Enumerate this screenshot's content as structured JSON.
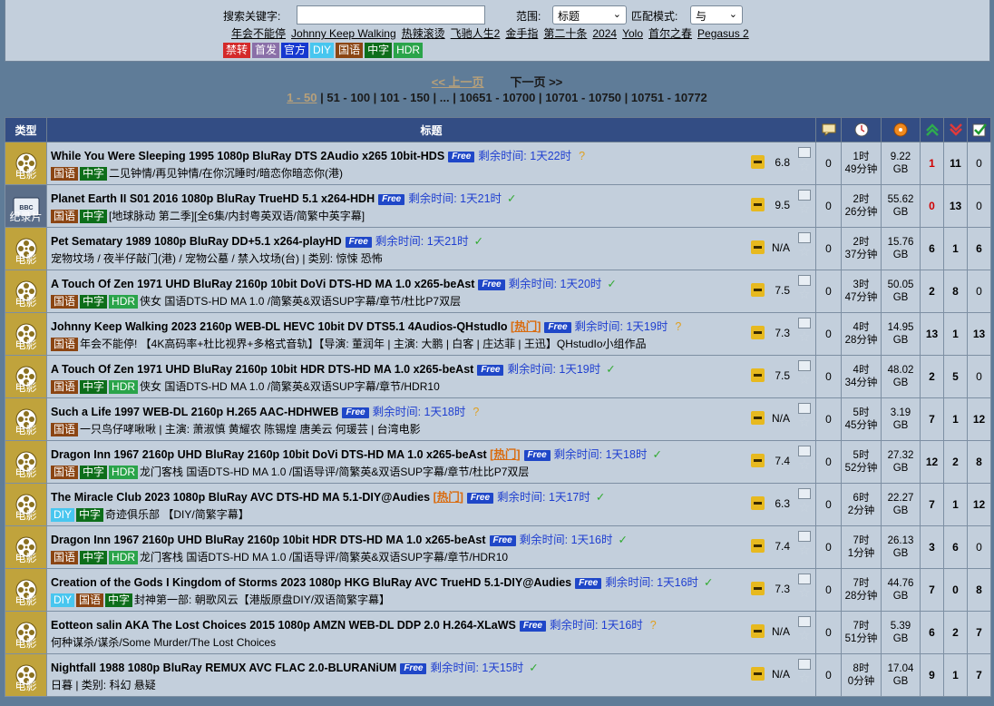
{
  "search": {
    "keyword_label": "搜索关键字:",
    "keyword_value": "",
    "scope_label": "范围:",
    "scope_value": "标题",
    "mode_label": "匹配模式:",
    "mode_value": "与",
    "hot_terms": [
      "年会不能停",
      "Johnny Keep Walking",
      "热辣滚烫",
      "飞驰人生2",
      "金手指",
      "第二十条",
      "2024",
      "Yolo",
      "首尔之春",
      "Pegasus 2"
    ],
    "filter_tags": [
      {
        "label": "禁转",
        "color": "#d42a2a"
      },
      {
        "label": "首发",
        "color": "#8a6fa8"
      },
      {
        "label": "官方",
        "color": "#1638d0"
      },
      {
        "label": "DIY",
        "color": "#48c6ef"
      },
      {
        "label": "国语",
        "color": "#8b4513"
      },
      {
        "label": "中字",
        "color": "#0d6e1a"
      },
      {
        "label": "HDR",
        "color": "#2aa44a"
      }
    ]
  },
  "pager": {
    "prev": "<< 上一页",
    "next": "下一页 >>",
    "current": "1 - 50",
    "pages": [
      "51 - 100",
      "101 - 150",
      "...",
      "10651 - 10700",
      "10701 - 10750",
      "10751 - 10772"
    ]
  },
  "table": {
    "col_type": "类型",
    "col_title": "标题",
    "rows": [
      {
        "type": "电影",
        "title": "While You Were Sleeping 1995 1080p BluRay DTS 2Audio x265 10bit-HDS",
        "hot": false,
        "remaining": "剩余时间: 1天22时",
        "mark": "?",
        "tags": [
          "国语",
          "中字"
        ],
        "sub": "二见钟情/再见钟情/在你沉睡时/暗恋你暗恋你(港)",
        "rating": "6.8",
        "comments": "0",
        "time1": "1时",
        "time2": "49分钟",
        "size1": "9.22",
        "size2": "GB",
        "seeders": "1",
        "leechers": "11",
        "done": "0",
        "seed_red": true
      },
      {
        "type": "纪录片",
        "title": "Planet Earth II S01 2016 1080p BluRay TrueHD 5.1 x264-HDH",
        "hot": false,
        "remaining": "剩余时间: 1天21时",
        "mark": "✓",
        "tags": [
          "国语",
          "中字"
        ],
        "sub": "[地球脉动 第二季][全6集/内封粤英双语/简繁中英字幕]",
        "rating": "9.5",
        "comments": "0",
        "time1": "2时",
        "time2": "26分钟",
        "size1": "55.62",
        "size2": "GB",
        "seeders": "0",
        "leechers": "13",
        "done": "0",
        "seed_red": true
      },
      {
        "type": "电影",
        "title": "Pet Sematary 1989 1080p BluRay DD+5.1 x264-playHD",
        "hot": false,
        "remaining": "剩余时间: 1天21时",
        "mark": "✓",
        "tags": [],
        "sub": "宠物坟场 / 夜半仔敲门(港) / 宠物公墓 / 禁入坟场(台) | 类别: 惊悚 恐怖",
        "rating": "N/A",
        "comments": "0",
        "time1": "2时",
        "time2": "37分钟",
        "size1": "15.76",
        "size2": "GB",
        "seeders": "6",
        "leechers": "1",
        "done": "6",
        "seed_red": false
      },
      {
        "type": "电影",
        "title": "A Touch Of Zen 1971 UHD BluRay 2160p 10bit DoVi DTS-HD MA 1.0 x265-beAst",
        "hot": false,
        "remaining": "剩余时间: 1天20时",
        "mark": "✓",
        "tags": [
          "国语",
          "中字",
          "HDR"
        ],
        "sub": "侠女 国语DTS-HD MA 1.0 /简繁英&双语SUP字幕/章节/杜比P7双层",
        "rating": "7.5",
        "comments": "0",
        "time1": "3时",
        "time2": "47分钟",
        "size1": "50.05",
        "size2": "GB",
        "seeders": "2",
        "leechers": "8",
        "done": "0",
        "seed_red": false
      },
      {
        "type": "电影",
        "title": "Johnny Keep Walking 2023 2160p WEB-DL HEVC 10bit DV DTS5.1 4Audios-QHstudIo",
        "hot": true,
        "remaining": "剩余时间: 1天19时",
        "mark": "?",
        "tags": [
          "国语"
        ],
        "sub": "年会不能停! 【4K高码率+杜比视界+多格式音轨】【导演: 董润年 | 主演: 大鹏 | 白客 | 庄达菲 | 王迅】QHstudIo小组作品",
        "rating": "7.3",
        "comments": "0",
        "time1": "4时",
        "time2": "28分钟",
        "size1": "14.95",
        "size2": "GB",
        "seeders": "13",
        "leechers": "1",
        "done": "13",
        "seed_red": false
      },
      {
        "type": "电影",
        "title": "A Touch Of Zen 1971 UHD BluRay 2160p 10bit HDR DTS-HD MA 1.0 x265-beAst",
        "hot": false,
        "remaining": "剩余时间: 1天19时",
        "mark": "✓",
        "tags": [
          "国语",
          "中字",
          "HDR"
        ],
        "sub": "侠女 国语DTS-HD MA 1.0 /简繁英&双语SUP字幕/章节/HDR10",
        "rating": "7.5",
        "comments": "0",
        "time1": "4时",
        "time2": "34分钟",
        "size1": "48.02",
        "size2": "GB",
        "seeders": "2",
        "leechers": "5",
        "done": "0",
        "seed_red": false
      },
      {
        "type": "电影",
        "title": "Such a Life 1997 WEB-DL 2160p H.265 AAC-HDHWEB",
        "hot": false,
        "remaining": "剩余时间: 1天18时",
        "mark": "?",
        "tags": [
          "国语"
        ],
        "sub": "一只鸟仔哮啾啾 | 主演: 萧淑慎 黄耀农 陈锡煌 唐美云 何瑗芸 | 台湾电影",
        "rating": "N/A",
        "comments": "0",
        "time1": "5时",
        "time2": "45分钟",
        "size1": "3.19",
        "size2": "GB",
        "seeders": "7",
        "leechers": "1",
        "done": "12",
        "seed_red": false
      },
      {
        "type": "电影",
        "title": "Dragon Inn 1967 2160p UHD BluRay 2160p 10bit DoVi DTS-HD MA 1.0 x265-beAst",
        "hot": true,
        "remaining": "剩余时间: 1天18时",
        "mark": "✓",
        "tags": [
          "国语",
          "中字",
          "HDR"
        ],
        "sub": "龙门客栈 国语DTS-HD MA 1.0 /国语导评/简繁英&双语SUP字幕/章节/杜比P7双层",
        "rating": "7.4",
        "comments": "0",
        "time1": "5时",
        "time2": "52分钟",
        "size1": "27.32",
        "size2": "GB",
        "seeders": "12",
        "leechers": "2",
        "done": "8",
        "seed_red": false
      },
      {
        "type": "电影",
        "title": "The Miracle Club 2023 1080p BluRay AVC DTS-HD MA 5.1-DIY@Audies",
        "hot": true,
        "remaining": "剩余时间: 1天17时",
        "mark": "✓",
        "tags": [
          "DIY",
          "中字"
        ],
        "sub": "奇迹俱乐部 【DIY/简繁字幕】",
        "rating": "6.3",
        "comments": "0",
        "time1": "6时",
        "time2": "2分钟",
        "size1": "22.27",
        "size2": "GB",
        "seeders": "7",
        "leechers": "1",
        "done": "12",
        "seed_red": false
      },
      {
        "type": "电影",
        "title": "Dragon Inn 1967 2160p UHD BluRay 2160p 10bit HDR DTS-HD MA 1.0 x265-beAst",
        "hot": false,
        "remaining": "剩余时间: 1天16时",
        "mark": "✓",
        "tags": [
          "国语",
          "中字",
          "HDR"
        ],
        "sub": "龙门客栈 国语DTS-HD MA 1.0 /国语导评/简繁英&双语SUP字幕/章节/HDR10",
        "rating": "7.4",
        "comments": "0",
        "time1": "7时",
        "time2": "1分钟",
        "size1": "26.13",
        "size2": "GB",
        "seeders": "3",
        "leechers": "6",
        "done": "0",
        "seed_red": false
      },
      {
        "type": "电影",
        "title": "Creation of the Gods I Kingdom of Storms 2023 1080p HKG BluRay AVC TrueHD 5.1-DIY@Audies",
        "hot": false,
        "remaining": "剩余时间: 1天16时",
        "mark": "✓",
        "tags": [
          "DIY",
          "国语",
          "中字"
        ],
        "sub": "封神第一部: 朝歌风云【港版原盘DIY/双语简繁字幕】",
        "rating": "7.3",
        "comments": "0",
        "time1": "7时",
        "time2": "28分钟",
        "size1": "44.76",
        "size2": "GB",
        "seeders": "7",
        "leechers": "0",
        "done": "8",
        "seed_red": false
      },
      {
        "type": "电影",
        "title": "Eotteon salin AKA The Lost Choices 2015 1080p AMZN WEB-DL DDP 2.0 H.264-XLaWS",
        "hot": false,
        "remaining": "剩余时间: 1天16时",
        "mark": "?",
        "tags": [],
        "sub": "何种谋杀/谋杀/Some Murder/The Lost Choices",
        "rating": "N/A",
        "comments": "0",
        "time1": "7时",
        "time2": "51分钟",
        "size1": "5.39",
        "size2": "GB",
        "seeders": "6",
        "leechers": "2",
        "done": "7",
        "seed_red": false
      },
      {
        "type": "电影",
        "title": "Nightfall 1988 1080p BluRay REMUX AVC FLAC 2.0-BLURANiUM",
        "hot": false,
        "remaining": "剩余时间: 1天15时",
        "mark": "✓",
        "tags": [],
        "sub": "日暮 | 类别: 科幻 悬疑",
        "rating": "N/A",
        "comments": "0",
        "time1": "8时",
        "time2": "0分钟",
        "size1": "17.04",
        "size2": "GB",
        "seeders": "9",
        "leechers": "1",
        "done": "7",
        "seed_red": false
      }
    ]
  },
  "colors": {
    "header": "#334d84",
    "row": "#c3cfdc",
    "type_cell": "#c0a33c",
    "free": "#1f47c8",
    "remaining": "#1f3fd0",
    "hot": "#d96b0e",
    "check": "#2faa2f"
  }
}
